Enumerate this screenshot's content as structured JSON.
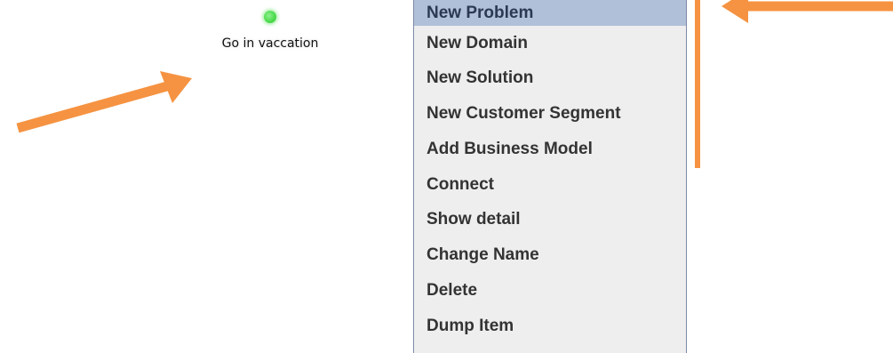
{
  "node": {
    "label": "Go in vaccation",
    "status_color": "#4fdc4f"
  },
  "menu": {
    "items": [
      {
        "label": "New Problem",
        "selected": true
      },
      {
        "label": "New Domain"
      },
      {
        "label": "New Solution"
      },
      {
        "label": "New Customer Segment"
      },
      {
        "label": "Add Business Model"
      },
      {
        "label": "Connect"
      },
      {
        "label": "Show detail"
      },
      {
        "label": "Change Name"
      },
      {
        "label": "Delete"
      },
      {
        "label": "Dump Item"
      }
    ]
  },
  "colors": {
    "accent_arrow": "#f59342",
    "menu_background": "#eeeeee",
    "menu_selection": "#b0c0d8"
  }
}
